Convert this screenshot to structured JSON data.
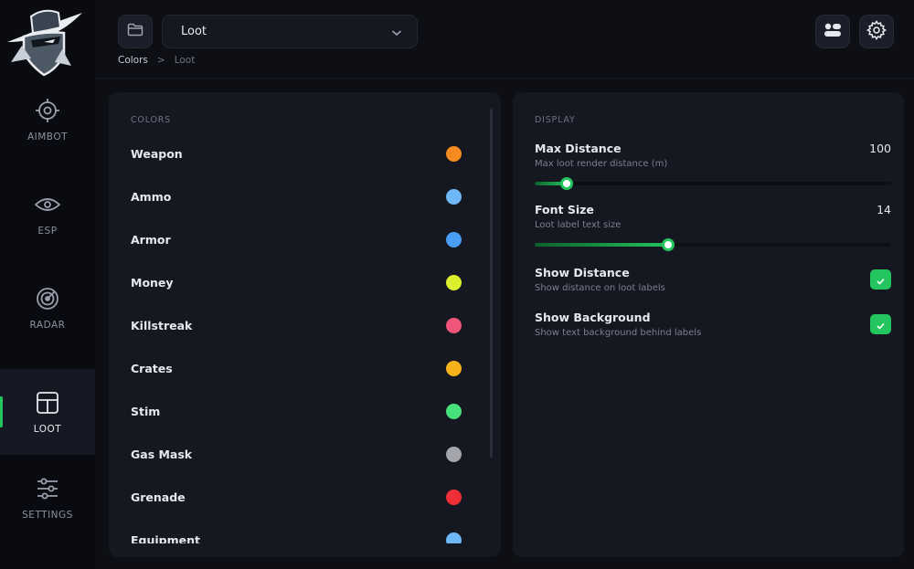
{
  "sidebar": {
    "items": [
      {
        "label": "AIMBOT",
        "icon": "crosshair-icon"
      },
      {
        "label": "ESP",
        "icon": "eye-icon"
      },
      {
        "label": "RADAR",
        "icon": "radar-icon"
      },
      {
        "label": "LOOT",
        "icon": "layout-icon",
        "active": true
      },
      {
        "label": "SETTINGS",
        "icon": "sliders-icon"
      }
    ]
  },
  "header": {
    "dropdown_value": "Loot",
    "breadcrumb": [
      "Colors",
      ">",
      "Loot"
    ]
  },
  "colors_panel": {
    "section_label": "COLORS",
    "items": [
      {
        "label": "Weapon",
        "color": "#f58a1f"
      },
      {
        "label": "Ammo",
        "color": "#6fb7f7"
      },
      {
        "label": "Armor",
        "color": "#4a9df5"
      },
      {
        "label": "Money",
        "color": "#dcef2c"
      },
      {
        "label": "Killstreak",
        "color": "#f2557a"
      },
      {
        "label": "Crates",
        "color": "#f6b21a"
      },
      {
        "label": "Stim",
        "color": "#47e27a"
      },
      {
        "label": "Gas Mask",
        "color": "#a4a6ab"
      },
      {
        "label": "Grenade",
        "color": "#ef2f37"
      },
      {
        "label": "Equipment",
        "color": "#6fb7f7"
      }
    ]
  },
  "display_panel": {
    "section_label": "DISPLAY",
    "max_distance": {
      "title": "Max Distance",
      "desc": "Max loot render distance (m)",
      "value": "100",
      "fraction": 0.09
    },
    "font_size": {
      "title": "Font Size",
      "desc": "Loot label text size",
      "value": "14",
      "fraction": 0.375
    },
    "show_distance": {
      "title": "Show Distance",
      "desc": "Show distance on loot labels",
      "checked": true
    },
    "show_background": {
      "title": "Show Background",
      "desc": "Show text background behind labels",
      "checked": true
    }
  },
  "colors": {
    "accent": "#22c55e"
  }
}
